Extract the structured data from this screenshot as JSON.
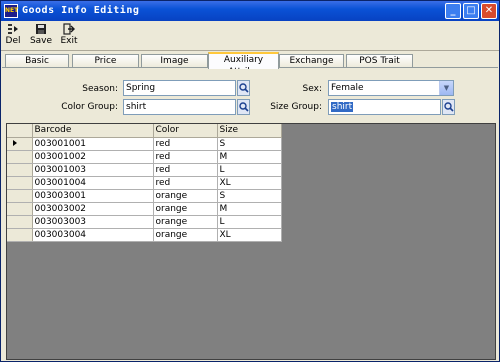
{
  "window": {
    "title": "Goods Info Editing",
    "icon_text": "NET",
    "minimize_glyph": "_",
    "maximize_glyph": "□",
    "close_glyph": "✕"
  },
  "toolbar": {
    "items": [
      {
        "label": "Del",
        "icon": "delete-icon"
      },
      {
        "label": "Save",
        "icon": "floppy-disk-icon"
      },
      {
        "label": "Exit",
        "icon": "exit-door-icon"
      }
    ]
  },
  "tabs": [
    "Basic",
    "Price",
    "Image",
    "Auxiliary Attribu",
    "Exchange unit",
    "POS Trait"
  ],
  "active_tab": "Auxiliary Attribu",
  "form": {
    "season_label": "Season:",
    "season_value": "Spring",
    "sex_label": "Sex:",
    "sex_value": "Female",
    "color_group_label": "Color Group:",
    "color_group_value": "shirt",
    "size_group_label": "Size Group:",
    "size_group_value": "shirt"
  },
  "grid": {
    "columns": [
      "Barcode",
      "Color",
      "Size"
    ],
    "rows": [
      [
        "003001001",
        "red",
        "S"
      ],
      [
        "003001002",
        "red",
        "M"
      ],
      [
        "003001003",
        "red",
        "L"
      ],
      [
        "003001004",
        "red",
        "XL"
      ],
      [
        "003003001",
        "orange",
        "S"
      ],
      [
        "003003002",
        "orange",
        "M"
      ],
      [
        "003003003",
        "orange",
        "L"
      ],
      [
        "003003004",
        "orange",
        "XL"
      ]
    ],
    "current_row": 0
  },
  "colors": {
    "title_bar": "#0a52d6",
    "active_tab_highlight": "#ffc83c",
    "selection": "#316ac5"
  }
}
